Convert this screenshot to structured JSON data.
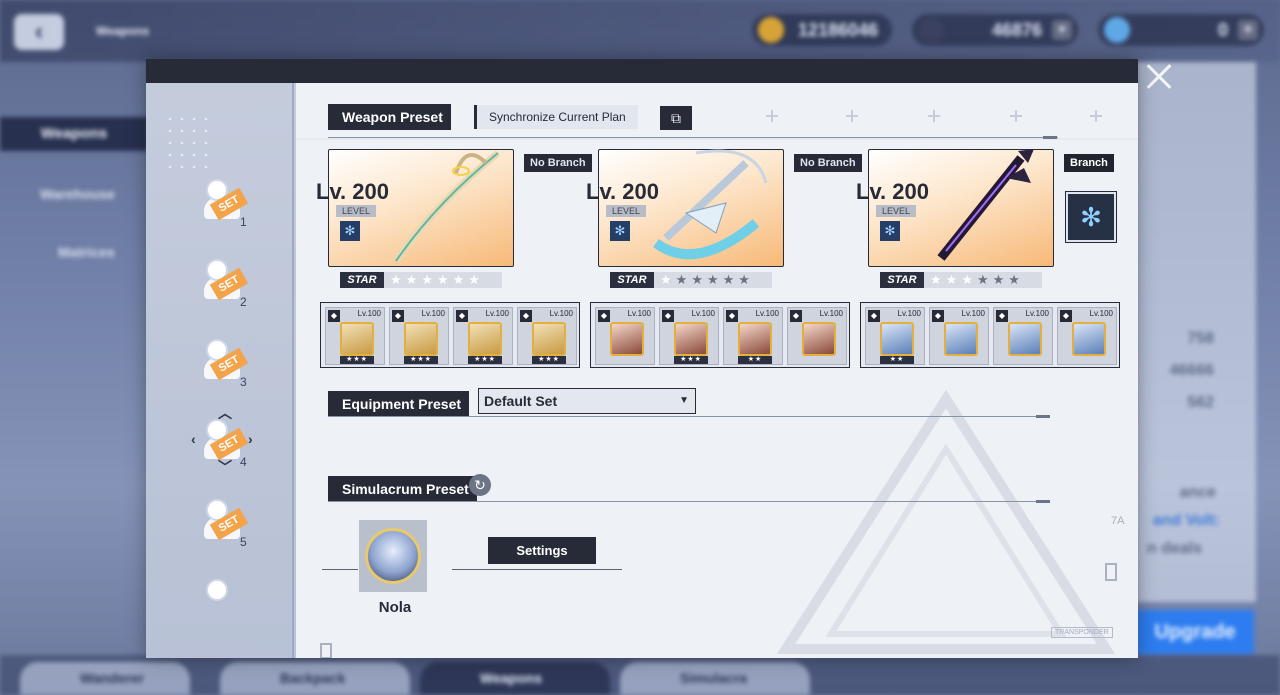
{
  "background": {
    "back_icon": "chevron-left-icon",
    "page_title": "Weapons",
    "resources": [
      {
        "icon": "gold-coin-icon",
        "value": "12186046",
        "color": "#d8a336"
      },
      {
        "icon": "dark-crystal-icon",
        "value": "46876",
        "color": "#3b4160"
      },
      {
        "icon": "tanium-icon",
        "value": "0",
        "color": "#5fa8e8"
      }
    ],
    "left_menu": [
      "Weapons",
      "Warehouse",
      "Matrices"
    ],
    "bottom_tabs": [
      "Wanderer",
      "Backpack",
      "Weapons",
      "Simulacra"
    ],
    "active_bottom_tab": "Weapons",
    "right_values": [
      "758",
      "46666",
      "562"
    ],
    "right_texts": [
      "ance",
      "and Volt:",
      "n deals"
    ],
    "upgrade_label": "Upgrade"
  },
  "modal": {
    "close_icon": "close-icon",
    "sidebar_sets": [
      {
        "tag": "SET",
        "number": "1"
      },
      {
        "tag": "SET",
        "number": "2"
      },
      {
        "tag": "SET",
        "number": "3"
      },
      {
        "tag": "SET",
        "number": "4"
      },
      {
        "tag": "SET",
        "number": "5"
      }
    ],
    "weapon_preset": {
      "title": "Weapon Preset",
      "sync_label": "Synchronize Current Plan",
      "sync_icon": "sync-icon",
      "weapons": [
        {
          "level": "Lv. 200",
          "level_tag": "LEVEL",
          "star_label": "STAR",
          "stars_filled": 6,
          "stars_total": 6,
          "branch": "No Branch",
          "element_icon": "frost-icon"
        },
        {
          "level": "Lv. 200",
          "level_tag": "LEVEL",
          "star_label": "STAR",
          "stars_filled": 1,
          "stars_total": 6,
          "branch": "No Branch",
          "element_icon": "frost-icon"
        },
        {
          "level": "Lv. 200",
          "level_tag": "LEVEL",
          "star_label": "STAR",
          "stars_filled": 3,
          "stars_total": 6,
          "branch": "Branch",
          "element_icon": "frost-icon"
        }
      ],
      "branch_icon": "frost-branch-icon"
    },
    "matrix_groups": [
      {
        "items": [
          {
            "level": "Lv.100",
            "stars": "★★★"
          },
          {
            "level": "Lv.100",
            "stars": "★★★"
          },
          {
            "level": "Lv.100",
            "stars": "★★★"
          },
          {
            "level": "Lv.100",
            "stars": "★★★"
          }
        ]
      },
      {
        "items": [
          {
            "level": "Lv.100",
            "stars": ""
          },
          {
            "level": "Lv.100",
            "stars": "★★★"
          },
          {
            "level": "Lv.100",
            "stars": "★★"
          },
          {
            "level": "Lv.100",
            "stars": ""
          }
        ]
      },
      {
        "items": [
          {
            "level": "Lv.100",
            "stars": "★★"
          },
          {
            "level": "Lv.100",
            "stars": ""
          },
          {
            "level": "Lv.100",
            "stars": ""
          },
          {
            "level": "Lv.100",
            "stars": ""
          }
        ]
      }
    ],
    "equipment_preset": {
      "title": "Equipment Preset",
      "selected": "Default Set",
      "caret_icon": "chevron-down-icon"
    },
    "simulacrum_preset": {
      "title": "Simulacrum Preset",
      "refresh_icon": "refresh-icon",
      "simulacrum_name": "Nola",
      "settings_label": "Settings"
    },
    "deco": {
      "transponder": "TRANSPONDER",
      "code": "7A"
    }
  }
}
